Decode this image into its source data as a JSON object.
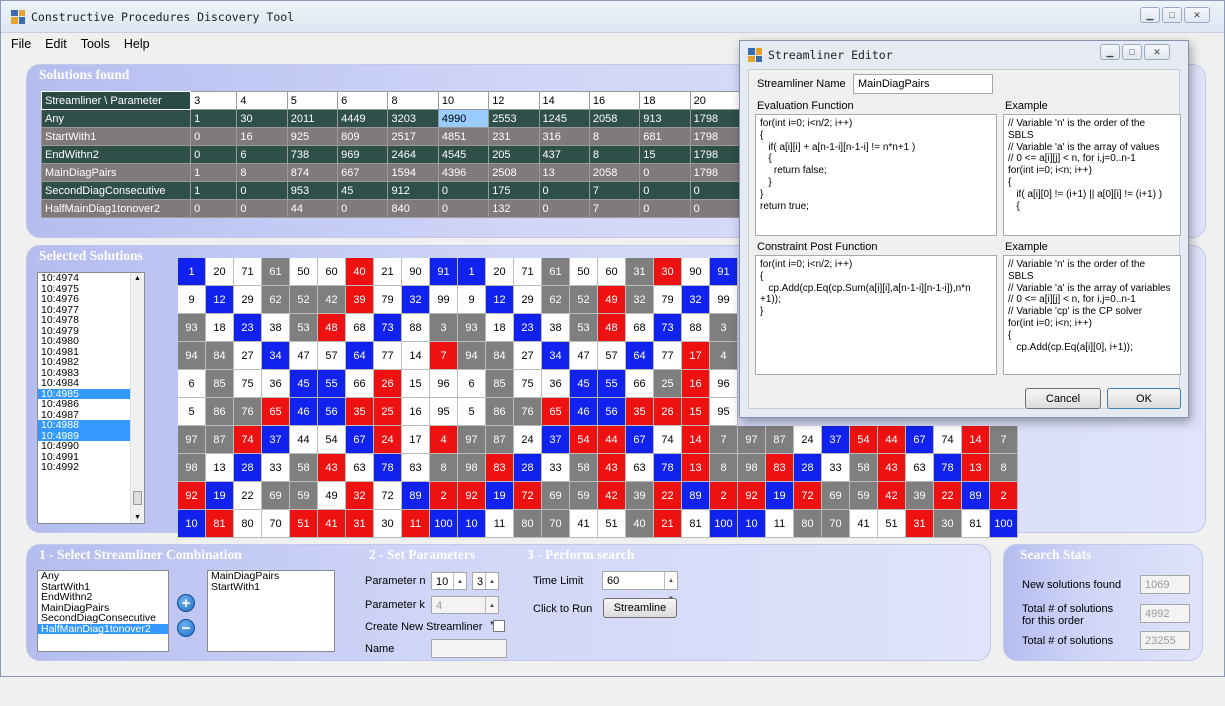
{
  "window": {
    "title": "Constructive Procedures Discovery Tool"
  },
  "menu": [
    "File",
    "Edit",
    "Tools",
    "Help"
  ],
  "solutions": {
    "title": "Solutions found",
    "header": [
      "Streamliner \\ Parameter",
      "3",
      "4",
      "5",
      "6",
      "8",
      "10",
      "12",
      "14",
      "16",
      "18",
      "20"
    ],
    "rows": [
      [
        "Any",
        "1",
        "30",
        "2011",
        "4449",
        "3203",
        "4990",
        "2553",
        "1245",
        "2058",
        "913",
        "1798"
      ],
      [
        "StartWith1",
        "0",
        "16",
        "925",
        "809",
        "2517",
        "4851",
        "231",
        "316",
        "8",
        "681",
        "1798"
      ],
      [
        "EndWithn2",
        "0",
        "6",
        "738",
        "969",
        "2464",
        "4545",
        "205",
        "437",
        "8",
        "15",
        "1798"
      ],
      [
        "MainDiagPairs",
        "1",
        "8",
        "874",
        "667",
        "1594",
        "4396",
        "2508",
        "13",
        "2058",
        "0",
        "1798"
      ],
      [
        "SecondDiagConsecutive",
        "1",
        "0",
        "953",
        "45",
        "912",
        "0",
        "175",
        "0",
        "7",
        "0",
        "0"
      ],
      [
        "HalfMainDiag1tonover2",
        "0",
        "0",
        "44",
        "0",
        "840",
        "0",
        "132",
        "0",
        "7",
        "0",
        "0"
      ]
    ]
  },
  "selected": {
    "title": "Selected Solutions",
    "list": [
      "10:4974",
      "10:4975",
      "10:4976",
      "10:4977",
      "10:4978",
      "10:4979",
      "10:4980",
      "10:4981",
      "10:4982",
      "10:4983",
      "10:4984",
      "10:4985",
      "10:4986",
      "10:4987",
      "10:4988",
      "10:4989",
      "10:4990",
      "10:4991",
      "10:4992"
    ],
    "selected_indices": [
      11,
      14,
      15
    ],
    "grid1": [
      [
        1,
        20,
        71,
        61,
        50,
        60,
        40,
        21,
        90,
        91
      ],
      [
        9,
        12,
        29,
        62,
        52,
        42,
        39,
        79,
        32,
        99
      ],
      [
        93,
        18,
        23,
        38,
        53,
        48,
        68,
        73,
        88,
        3
      ],
      [
        94,
        84,
        27,
        34,
        47,
        57,
        64,
        77,
        14,
        7
      ],
      [
        6,
        85,
        75,
        36,
        45,
        55,
        66,
        26,
        15,
        96
      ],
      [
        5,
        86,
        76,
        65,
        46,
        56,
        35,
        25,
        16,
        95
      ],
      [
        97,
        87,
        74,
        37,
        44,
        54,
        67,
        24,
        17,
        4
      ],
      [
        98,
        13,
        28,
        33,
        58,
        43,
        63,
        78,
        83,
        8
      ],
      [
        92,
        19,
        22,
        69,
        59,
        49,
        32,
        72,
        89,
        2
      ],
      [
        10,
        81,
        80,
        70,
        51,
        41,
        31,
        30,
        11,
        100
      ]
    ],
    "colors1": [
      "bwwgwwrwwb",
      "wbwgggrwbw",
      "gwbwgrwbwg",
      "ggwbwwbwwr",
      "wgwwbbwrww",
      "wggrbbrrww",
      "ggrbwwbrwr",
      "gwbwgrwbwg",
      "rbwggwrwbr",
      "brwwrrrwrb"
    ],
    "grid2": [
      [
        1,
        20,
        71,
        61,
        50,
        60,
        31,
        30,
        90,
        91
      ],
      [
        9,
        12,
        29,
        62,
        52,
        49,
        32,
        79,
        32,
        99
      ],
      [
        93,
        18,
        23,
        38,
        53,
        48,
        68,
        73,
        88,
        3
      ],
      [
        94,
        84,
        27,
        34,
        47,
        57,
        64,
        77,
        17,
        4
      ],
      [
        6,
        85,
        75,
        36,
        45,
        55,
        66,
        25,
        16,
        96
      ],
      [
        5,
        86,
        76,
        65,
        46,
        56,
        35,
        26,
        15,
        95
      ],
      [
        97,
        87,
        24,
        37,
        54,
        44,
        67,
        74,
        14,
        7
      ],
      [
        98,
        83,
        28,
        33,
        58,
        43,
        63,
        78,
        13,
        8
      ],
      [
        92,
        19,
        72,
        69,
        59,
        42,
        39,
        22,
        89,
        2
      ],
      [
        10,
        11,
        80,
        70,
        41,
        51,
        40,
        21,
        81,
        100
      ]
    ],
    "colors2": [
      "bwwgwwgrwb",
      "wbwggrgwbw",
      "gwbwgrwbwg",
      "ggwbwwbwrg",
      "wgwwbbwgrw",
      "wggrbbrrrw",
      "ggwbrrbwrg",
      "grbwgrwbrg",
      "rbrggrgrbr",
      "bwggwwgrwb"
    ],
    "grid3": [
      [
        97,
        87,
        24,
        37,
        54,
        44,
        67,
        74,
        14,
        7
      ],
      [
        98,
        83,
        28,
        33,
        58,
        43,
        63,
        78,
        13,
        8
      ],
      [
        92,
        19,
        72,
        69,
        59,
        42,
        39,
        22,
        89,
        2
      ],
      [
        10,
        11,
        80,
        70,
        41,
        51,
        31,
        30,
        81,
        100
      ]
    ],
    "colors3": [
      "ggwbrrbwrg",
      "grbwgrwbrg",
      "rbrggrgrbr",
      "bwggwwrgwb"
    ]
  },
  "editor": {
    "title": "Streamliner Editor",
    "name_label": "Streamliner Name",
    "name_value": "MainDiagPairs",
    "eval_label": "Evaluation Function",
    "eval_code": "for(int i=0; i<n/2; i++)\n{\n   if( a[i][i] + a[n-1-i][n-1-i] != n*n+1 )\n   {\n     return false;\n   }\n}\nreturn true;",
    "example_label": "Example",
    "example1": "// Variable 'n' is the order of the\nSBLS\n// Variable 'a' is the array of values\n// 0 <= a[i][j] < n, for i,j=0..n-1\nfor(int i=0; i<n; i++)\n{\n   if( a[i][0] != (i+1) || a[0][i] != (i+1) )\n   {",
    "post_label": "Constraint Post Function",
    "post_code": "for(int i=0; i<n/2; i++)\n{\n   cp.Add(cp.Eq(cp.Sum(a[i][i],a[n-1-i][n-1-i]),n*n\n+1));\n}",
    "example2": "// Variable 'n' is the order of the\nSBLS\n// Variable 'a' is the array of variables\n// 0 <= a[i][j] < n, for i,j=0..n-1\n// Variable 'cp' is the CP solver\nfor(int i=0; i<n; i++)\n{\n   cp.Add(cp.Eq(a[i][0], i+1));",
    "cancel": "Cancel",
    "ok": "OK"
  },
  "combo": {
    "title": "1 - Select Streamliner Combination",
    "left": [
      "Any",
      "StartWith1",
      "EndWithn2",
      "MainDiagPairs",
      "SecondDiagConsecutive",
      "HalfMainDiag1tonover2"
    ],
    "left_selected": 5,
    "right": [
      "MainDiagPairs",
      "StartWith1"
    ]
  },
  "params": {
    "title": "2 - Set Parameters",
    "n_label": "Parameter n",
    "n_value": "10",
    "n_value2": "3",
    "k_label": "Parameter k",
    "k_value": "4",
    "create_label": "Create New Streamliner",
    "name_label": "Name"
  },
  "search": {
    "title": "3 - Perform search",
    "time_label": "Time Limit",
    "time_value": "60",
    "run_label": "Click to Run",
    "run_button": "Streamline"
  },
  "stats": {
    "title": "Search Stats",
    "new_label": "New solutions found",
    "new_value": "1069",
    "total_order_label1": "Total # of solutions",
    "total_order_label2": "for this order",
    "total_order_value": "4992",
    "total_label": "Total # of solutions",
    "total_value": "23255"
  }
}
